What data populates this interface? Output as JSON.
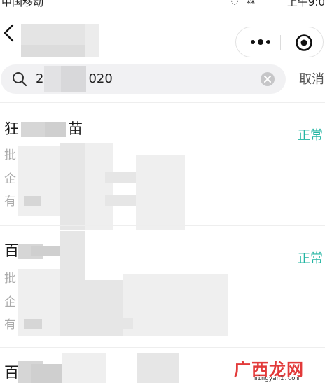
{
  "status_bar": {
    "carrier": "中国移动",
    "time": "上午9:0"
  },
  "nav": {
    "back_icon": "chevron-left-icon",
    "more_icon": "more-dots-icon",
    "close_icon": "target-close-icon"
  },
  "search": {
    "value_prefix": "2",
    "value_suffix": "020",
    "cancel_label": "取消",
    "search_icon": "search-icon",
    "clear_icon": "clear-icon"
  },
  "results": [
    {
      "title_start": "狂",
      "title_end": "苗",
      "status": "正常",
      "fields": [
        "批",
        "企",
        "有"
      ]
    },
    {
      "title_start": "百",
      "title_end": "",
      "status": "正常",
      "fields": [
        "批",
        "企",
        "有"
      ]
    },
    {
      "title_start": "百",
      "title_end": "",
      "status": "",
      "fields": []
    }
  ],
  "watermark": {
    "brand": "广西龙网",
    "url": "mingyan1.com"
  },
  "colors": {
    "status_green": "#22b5a2",
    "watermark_red": "#e23a3a"
  }
}
